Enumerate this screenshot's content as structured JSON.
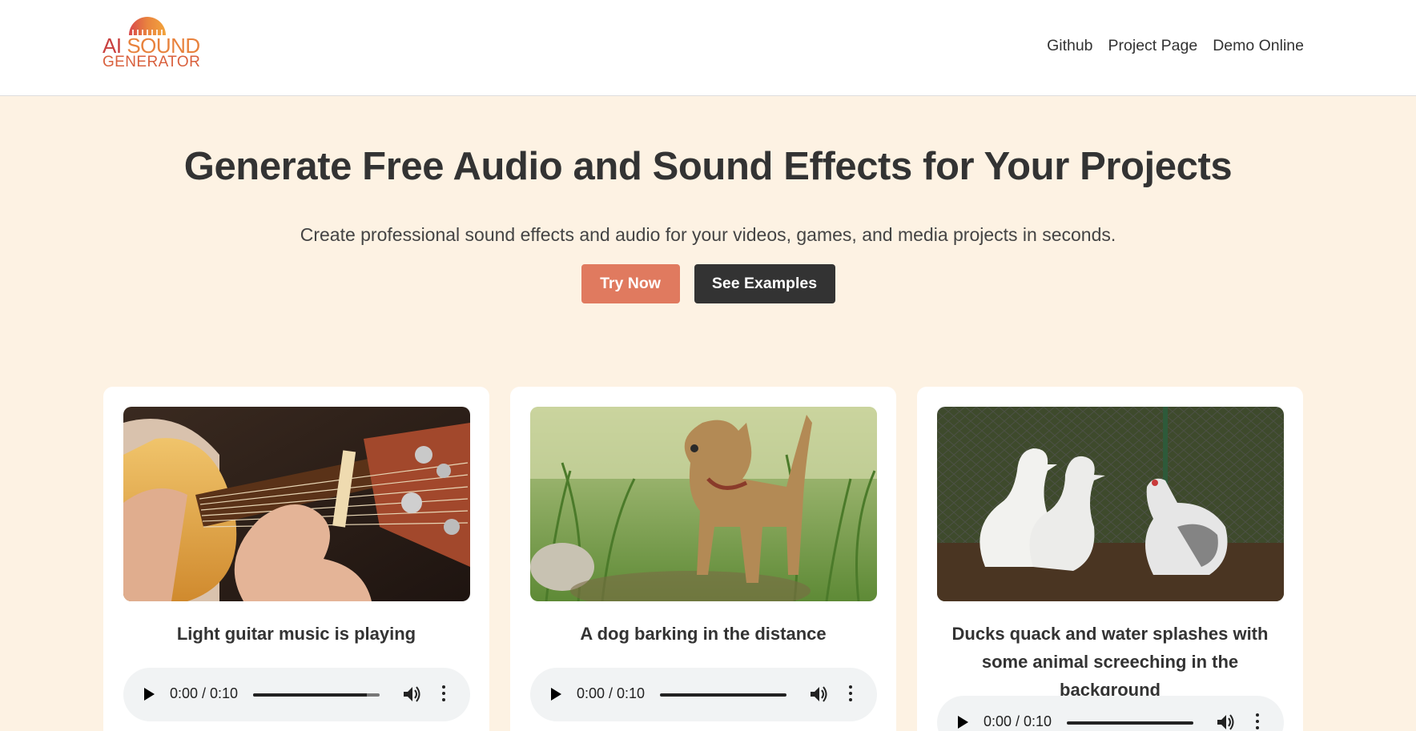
{
  "header": {
    "logo": {
      "line1_ai": "AI",
      "line1_sound": "SOUND",
      "line2": "GENERATOR"
    },
    "nav": [
      {
        "label": "Github"
      },
      {
        "label": "Project Page"
      },
      {
        "label": "Demo Online"
      }
    ]
  },
  "hero": {
    "title": "Generate Free Audio and Sound Effects for Your Projects",
    "subtitle": "Create professional sound effects and audio for your videos, games, and media projects in seconds.",
    "primary_button": "Try Now",
    "secondary_button": "See Examples"
  },
  "colors": {
    "accent": "#e07a5f",
    "dark_button": "#333333",
    "hero_background": "#fdf2e3"
  },
  "examples": [
    {
      "caption": "Light guitar music is playing",
      "image": "guitar-photo",
      "player": {
        "time": "0:00 / 0:10",
        "progress": 0.9
      }
    },
    {
      "caption": "A dog barking in the distance",
      "image": "dog-photo",
      "player": {
        "time": "0:00 / 0:10",
        "progress": 1.0
      }
    },
    {
      "caption": "Ducks quack and water splashes with some animal screeching in the background",
      "image": "ducks-photo",
      "player": {
        "time": "0:00 / 0:10",
        "progress": 1.0
      }
    }
  ],
  "icons": {
    "play": "play-icon",
    "volume": "volume-icon",
    "more": "more-options-icon"
  }
}
